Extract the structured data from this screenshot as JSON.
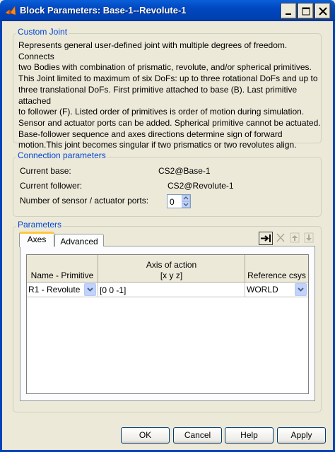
{
  "window": {
    "title": "Block Parameters: Base-1--Revolute-1"
  },
  "custom_joint": {
    "group_title": "Custom Joint",
    "description_lines": [
      "Represents general user-defined joint with multiple degrees of freedom. Connects",
      "two Bodies with combination of prismatic, revolute, and/or spherical primitives.",
      "This Joint limited to maximum of six DoFs: up to three rotational DoFs and up to",
      "three translational DoFs. First primitive attached to base (B). Last primitive attached",
      "to follower (F). Listed order of primitives is order of motion during simulation.",
      "Sensor and actuator ports can be added. Spherical primitive cannot be actuated.",
      "Base-follower sequence and axes directions determine sign of forward",
      "motion.This joint becomes singular if two prismatics or two revolutes align."
    ]
  },
  "connection": {
    "group_title": "Connection parameters",
    "current_base_label": "Current base:",
    "current_base_value": "CS2@Base-1",
    "current_follower_label": "Current follower:",
    "current_follower_value": "CS2@Revolute-1",
    "ports_label": "Number of sensor / actuator ports:",
    "ports_value": "0"
  },
  "parameters": {
    "group_title": "Parameters",
    "tabs": [
      "Axes",
      "Advanced"
    ],
    "active_tab": "Axes",
    "table": {
      "headers": {
        "name": "Name - Primitive",
        "axis_line1": "Axis of action",
        "axis_line2": "[x y z]",
        "ref": "Reference csys"
      },
      "rows": [
        {
          "name": "R1 - Revolute",
          "axis": "[0 0 -1]",
          "ref": "WORLD"
        }
      ]
    }
  },
  "buttons": {
    "ok": "OK",
    "cancel": "Cancel",
    "help": "Help",
    "apply": "Apply"
  },
  "colors": {
    "titlebar": "#0047c0",
    "group_title": "#0046d5",
    "dialog_bg": "#ece9d8"
  }
}
